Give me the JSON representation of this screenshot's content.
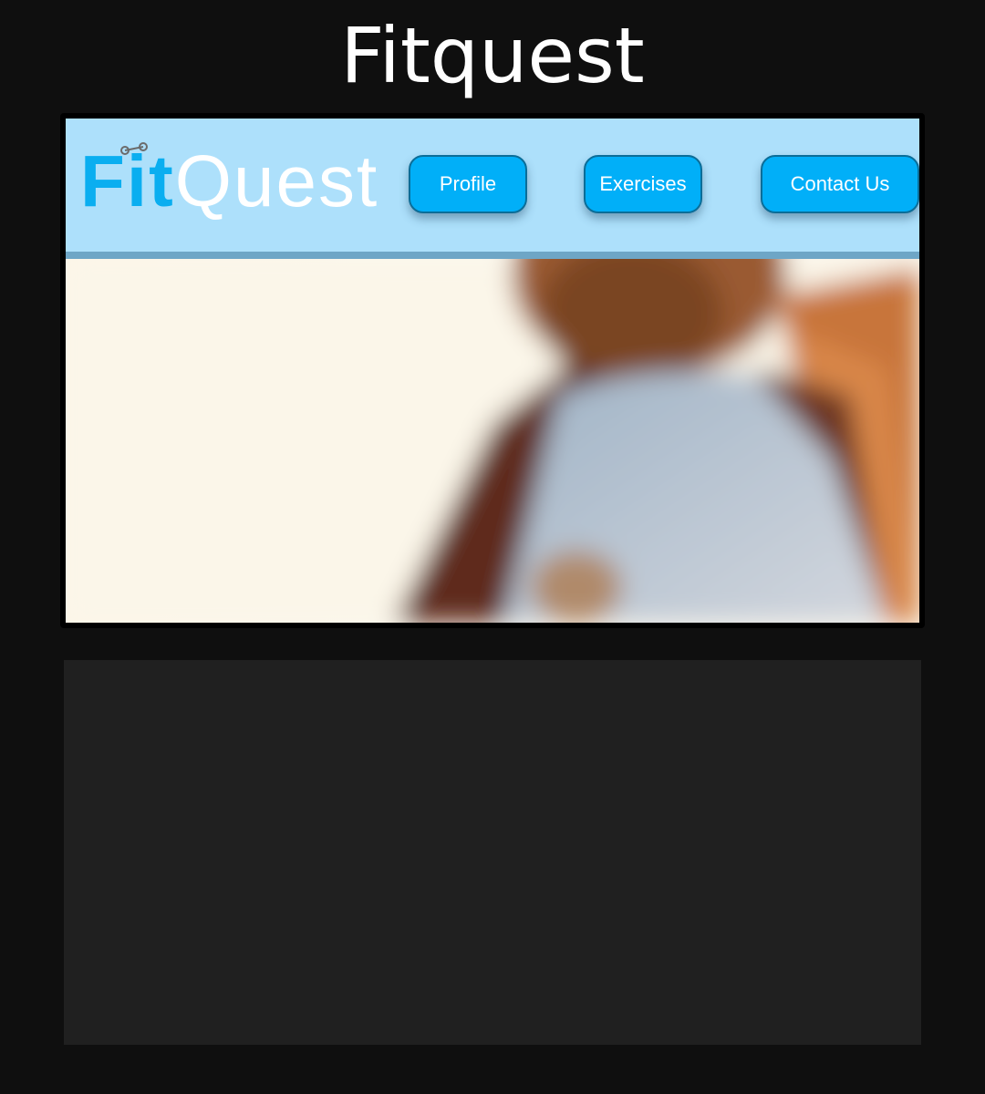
{
  "window": {
    "title": "Fitquest"
  },
  "site": {
    "logo": {
      "part1": "Fit",
      "part2": "Quest",
      "icon": "dumbbell-icon"
    },
    "nav": [
      {
        "label": "Profile"
      },
      {
        "label": "Exercises"
      },
      {
        "label": "Contact Us"
      }
    ],
    "hero": {
      "image": "blurred-athlete-photo"
    }
  },
  "colors": {
    "page_background": "#0f0f0f",
    "header_background": "#ade0fb",
    "nav_button": "#01aff8",
    "logo_accent": "#0aaef0",
    "panel": "#202020"
  }
}
